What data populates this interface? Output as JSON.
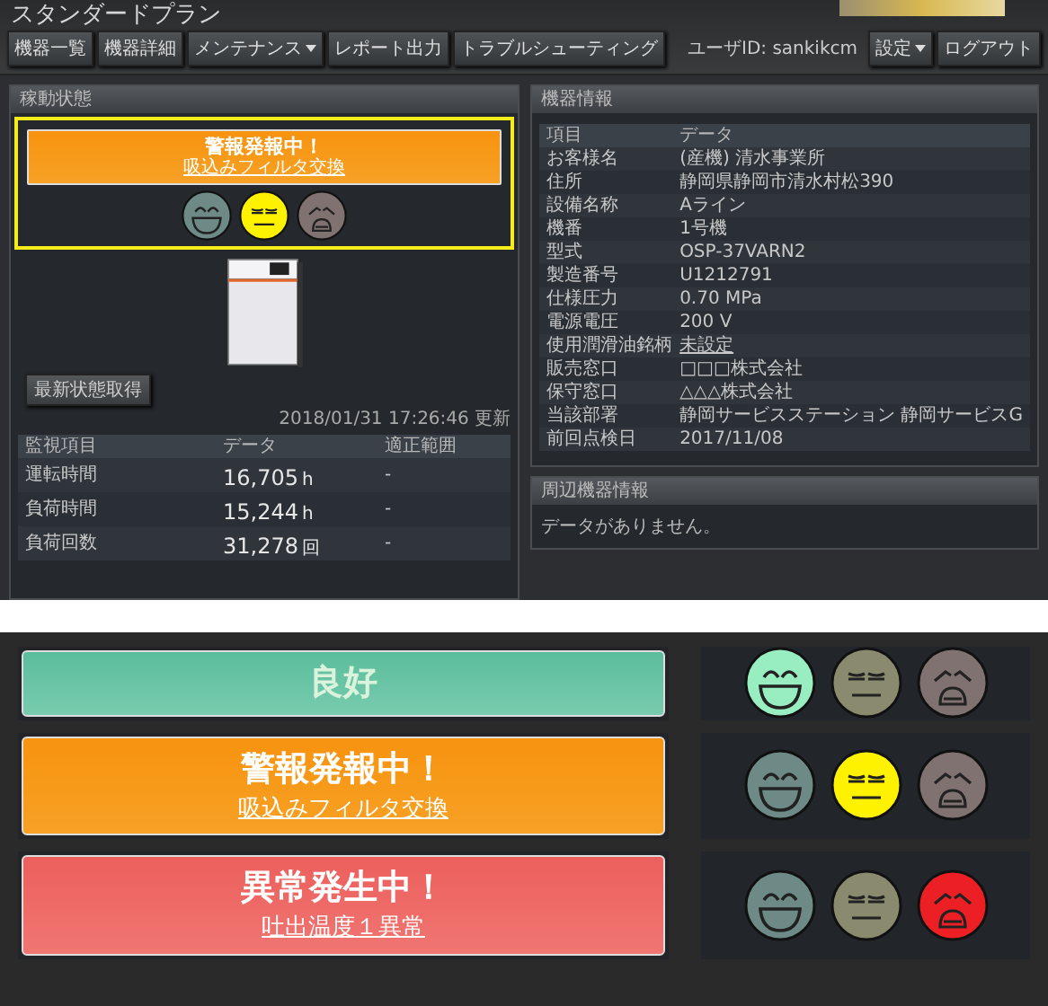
{
  "header": {
    "title": "スタンダードプラン",
    "user_id": "ユーザID: sankikcm"
  },
  "nav": [
    {
      "label": "機器一覧",
      "dropdown": false
    },
    {
      "label": "機器詳細",
      "dropdown": false
    },
    {
      "label": "メンテナンス",
      "dropdown": true
    },
    {
      "label": "レポート出力",
      "dropdown": false
    },
    {
      "label": "トラブルシューティング",
      "dropdown": false
    }
  ],
  "user_menu": [
    {
      "label": "設定",
      "dropdown": true
    },
    {
      "label": "ログアウト",
      "dropdown": false
    }
  ],
  "operation_panel": {
    "title": "稼動状態",
    "alert": {
      "kind": "warning",
      "highlighted": true,
      "title": "警報発報中！",
      "detail": "吸込みフィルタ交換",
      "faces": [
        {
          "kind": "happy",
          "selected": false
        },
        {
          "kind": "neutral",
          "selected": true
        },
        {
          "kind": "sad",
          "selected": false
        }
      ]
    },
    "refresh_button": "最新状態取得",
    "updated": "2018/01/31 17:26:46 更新",
    "table": {
      "columns": [
        "監視項目",
        "データ",
        "適正範囲"
      ],
      "rows": [
        {
          "item": "運転時間",
          "value": "16,705",
          "unit": "h",
          "range": "-"
        },
        {
          "item": "負荷時間",
          "value": "15,244",
          "unit": "h",
          "range": "-"
        },
        {
          "item": "負荷回数",
          "value": "31,278",
          "unit": "回",
          "range": "-"
        }
      ]
    }
  },
  "device_panel": {
    "title": "機器情報",
    "columns": [
      "項目",
      "データ"
    ],
    "rows": [
      {
        "label": "お客様名",
        "value": "(産機) 清水事業所",
        "link": false
      },
      {
        "label": "住所",
        "value": "静岡県静岡市清水村松390",
        "link": false
      },
      {
        "label": "設備名称",
        "value": "Aライン",
        "link": false
      },
      {
        "label": "機番",
        "value": "1号機",
        "link": false
      },
      {
        "label": "型式",
        "value": "OSP-37VARN2",
        "link": false
      },
      {
        "label": "製造番号",
        "value": "U1212791",
        "link": false
      },
      {
        "label": "仕様圧力",
        "value": "0.70 MPa",
        "link": false
      },
      {
        "label": "電源電圧",
        "value": "200 V",
        "link": false
      },
      {
        "label": "使用潤滑油銘柄",
        "value": "未設定",
        "link": true
      },
      {
        "label": "販売窓口",
        "value": "□□□株式会社",
        "link": false
      },
      {
        "label": "保守窓口",
        "value": "△△△株式会社",
        "link": false
      },
      {
        "label": "当該部署",
        "value": "静岡サービスステーション 静岡サービスG",
        "link": false
      },
      {
        "label": "前回点検日",
        "value": "2017/11/08",
        "link": false
      }
    ]
  },
  "peripheral_panel": {
    "title": "周辺機器情報",
    "message": "データがありません。"
  },
  "status_legend": [
    {
      "kind": "good",
      "title": "良好",
      "faces": [
        {
          "kind": "happy",
          "selected": true
        },
        {
          "kind": "neutral",
          "selected": false
        },
        {
          "kind": "sad",
          "selected": false
        }
      ]
    },
    {
      "kind": "warning",
      "title": "警報発報中！",
      "detail": "吸込みフィルタ交換",
      "faces": [
        {
          "kind": "happy",
          "selected": false
        },
        {
          "kind": "neutral",
          "selected": true
        },
        {
          "kind": "sad",
          "selected": false
        }
      ]
    },
    {
      "kind": "error",
      "title": "異常発生中！",
      "detail": "吐出温度１異常",
      "faces": [
        {
          "kind": "happy",
          "selected": false
        },
        {
          "kind": "neutral",
          "selected": false
        },
        {
          "kind": "sad",
          "selected": true
        }
      ]
    }
  ]
}
